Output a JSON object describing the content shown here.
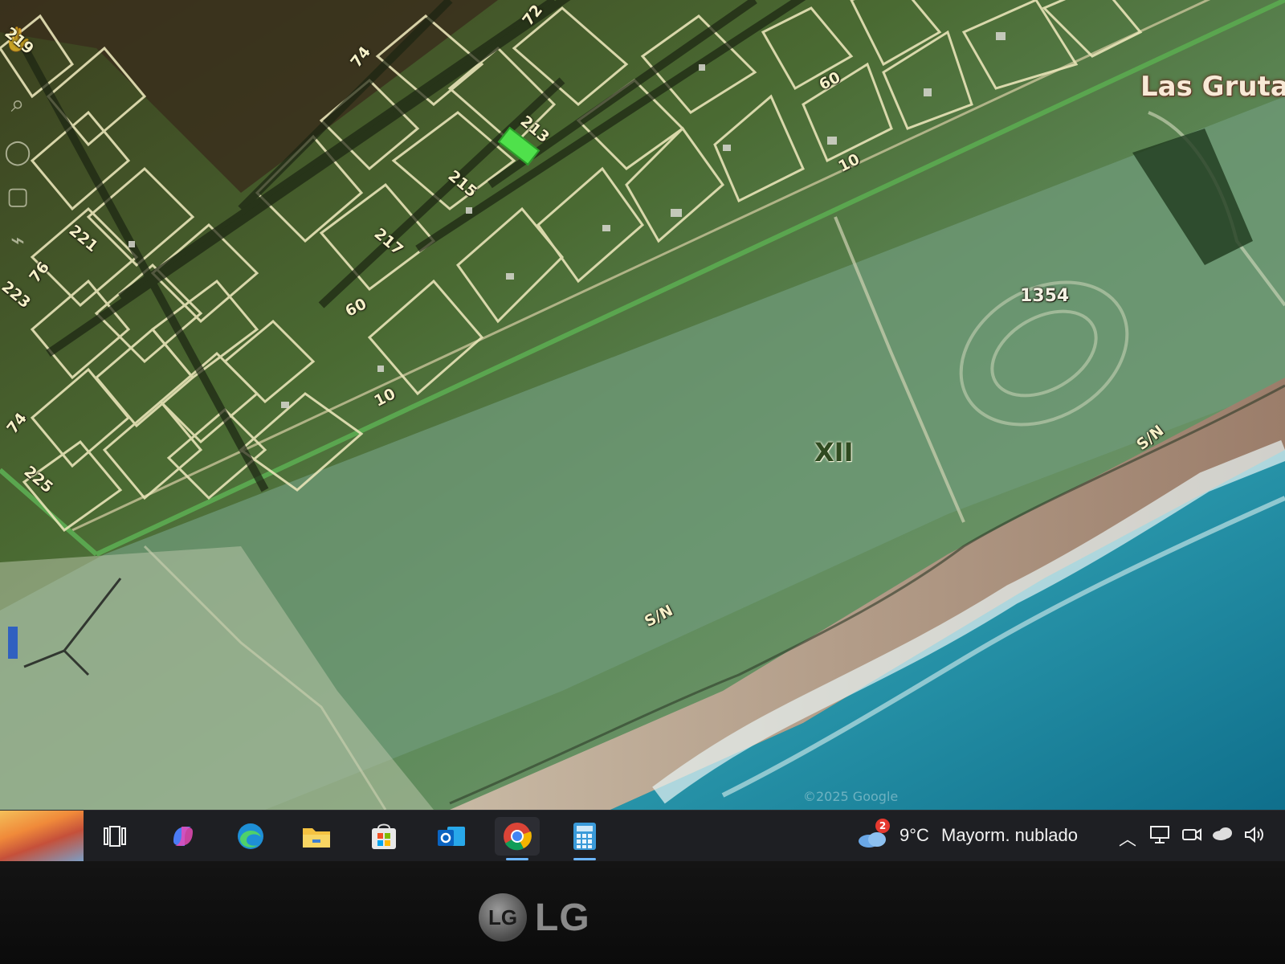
{
  "map": {
    "place_name": "Las Gruta",
    "zone_label": "XII",
    "parcel_number": "1354",
    "street_labels": [
      {
        "id": "l72",
        "text": "72"
      },
      {
        "id": "l74a",
        "text": "74"
      },
      {
        "id": "l60a",
        "text": "60"
      },
      {
        "id": "l213",
        "text": "213"
      },
      {
        "id": "l215",
        "text": "215"
      },
      {
        "id": "l217",
        "text": "217"
      },
      {
        "id": "l10a",
        "text": "10"
      },
      {
        "id": "l60b",
        "text": "60"
      },
      {
        "id": "l221",
        "text": "221"
      },
      {
        "id": "l219",
        "text": "219"
      },
      {
        "id": "l76",
        "text": "76"
      },
      {
        "id": "l223",
        "text": "223"
      },
      {
        "id": "l10b",
        "text": "10"
      },
      {
        "id": "l74b",
        "text": "74"
      },
      {
        "id": "l225",
        "text": "225"
      },
      {
        "id": "lsn1",
        "text": "S/N"
      },
      {
        "id": "lsn2",
        "text": "S/N"
      }
    ],
    "watermark": "©2025 Google",
    "colors": {
      "lot_outline": "#e9e4b8",
      "route_outline": "#5aa64f",
      "selected_parcel": "#4fe14b",
      "sea": "#1f8fa6"
    }
  },
  "taskbar": {
    "weather_badge": "2",
    "temperature": "9°C",
    "condition": "Mayorm. nublado",
    "apps": [
      {
        "name": "task-view",
        "icon": "task-view-icon"
      },
      {
        "name": "copilot",
        "icon": "copilot-icon"
      },
      {
        "name": "edge",
        "icon": "edge-icon"
      },
      {
        "name": "file-explorer",
        "icon": "folder-icon"
      },
      {
        "name": "microsoft-store",
        "icon": "store-icon"
      },
      {
        "name": "outlook",
        "icon": "outlook-icon"
      },
      {
        "name": "chrome",
        "icon": "chrome-icon"
      },
      {
        "name": "calculator",
        "icon": "calculator-icon"
      }
    ],
    "tray": [
      "chevron-up-icon",
      "network-icon",
      "meet-now-icon",
      "onedrive-icon",
      "volume-icon"
    ]
  },
  "monitor": {
    "brand": "LG",
    "logo_letters": "LG"
  }
}
